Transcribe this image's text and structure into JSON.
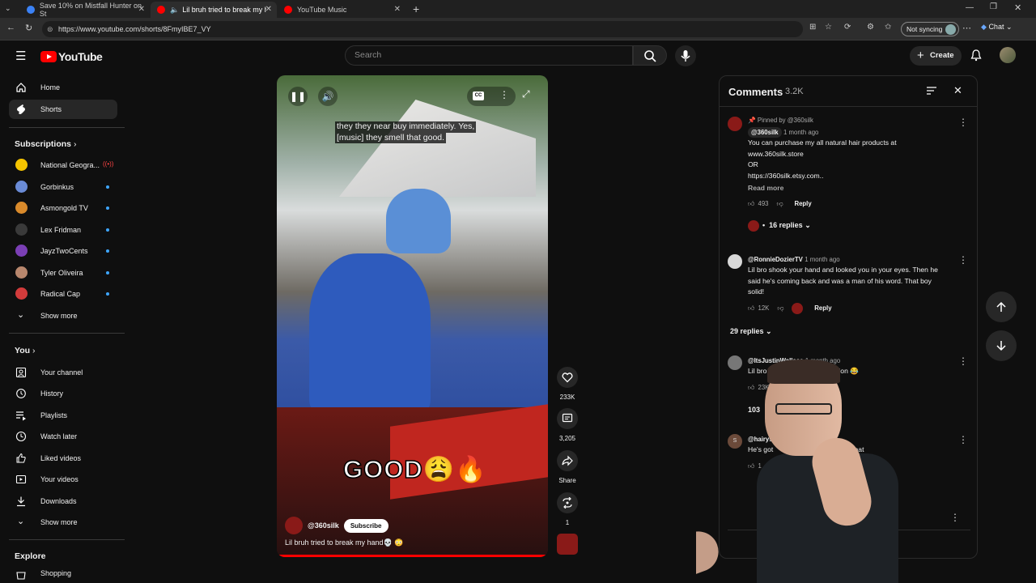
{
  "browser": {
    "tabs": [
      {
        "label": "Save 10% on Mistfall Hunter on St",
        "favicon_color": "#3b82f6"
      },
      {
        "label": "Lil bruh tried to break my hand",
        "favicon_color": "#ff0000"
      },
      {
        "label": "YouTube Music",
        "favicon_color": "#ff0000"
      }
    ],
    "url": "https://www.youtube.com/shorts/8FmyIBE7_VY",
    "sync_label": "Not syncing",
    "chat_label": "Chat"
  },
  "header": {
    "logo_text": "YouTube",
    "search_placeholder": "Search",
    "create_label": "Create"
  },
  "sidebar": {
    "main": [
      {
        "label": "Home",
        "icon": "home-icon"
      },
      {
        "label": "Shorts",
        "icon": "shorts-icon"
      }
    ],
    "subscriptions_title": "Subscriptions",
    "subscriptions": [
      {
        "label": "National Geogra...",
        "color": "#f5c400",
        "live": true
      },
      {
        "label": "Gorbinkus",
        "color": "#6a8bd6"
      },
      {
        "label": "Asmongold TV",
        "color": "#d98a2b"
      },
      {
        "label": "Lex Fridman",
        "color": "#2a2a2a"
      },
      {
        "label": "JayzTwoCents",
        "color": "#7b3fb5"
      },
      {
        "label": "Tyler Oliveira",
        "color": "#b8876d"
      },
      {
        "label": "Radical Cap",
        "color": "#d23b3b"
      }
    ],
    "show_more": "Show more",
    "you_title": "You",
    "you_items": [
      {
        "label": "Your channel",
        "icon": "account-icon"
      },
      {
        "label": "History",
        "icon": "history-icon"
      },
      {
        "label": "Playlists",
        "icon": "playlists-icon"
      },
      {
        "label": "Watch later",
        "icon": "watch-later-icon"
      },
      {
        "label": "Liked videos",
        "icon": "like-icon"
      },
      {
        "label": "Your videos",
        "icon": "your-videos-icon"
      },
      {
        "label": "Downloads",
        "icon": "download-icon"
      }
    ],
    "show_more_2": "Show more",
    "explore_title": "Explore",
    "explore_first": "Shopping"
  },
  "video": {
    "caption_line1": "they they near buy immediately. Yes,",
    "caption_line2": "[music] they smell that good.",
    "overlay_text": "GOOD😩🔥",
    "channel": "@360silk",
    "subscribe_label": "Subscribe",
    "title": "Lil bruh tried to break my hand💀 😳",
    "progress": 1.0
  },
  "actions": {
    "likes": "233K",
    "comments": "3,205",
    "share": "Share",
    "remix": "1"
  },
  "comments": {
    "title": "Comments",
    "count": "3.2K",
    "items": [
      {
        "pinned_label": "Pinned by @360silk",
        "user": "@360silk",
        "time": "1 month ago",
        "lines": [
          "You can purchase my all natural hair products at",
          "www.360silk.store",
          "OR",
          "https://360silk.etsy.com.."
        ],
        "read_more": "Read more",
        "likes": "493",
        "reply": "Reply",
        "replies": "16 replies",
        "avatar_color": "#8a1a18"
      },
      {
        "user": "@RonnieDozierTV",
        "time": "1 month ago",
        "lines": [
          "Lil bro shook your hand and looked you in your eyes. Then he",
          "said he's coming back and was a man of his word. That boy",
          "solid!"
        ],
        "likes": "12K",
        "reply": "Reply",
        "replies": "29 replies",
        "avatar_color": "#d8d8d8"
      },
      {
        "user": "@ItsJustinWallace",
        "time": "1 month ago",
        "lines": [
          "Lil bro di",
          "detention 😂"
        ],
        "likes": "23K",
        "replies": "103",
        "avatar_color": "#777777"
      },
      {
        "user": "@hairys",
        "lines": [
          "He's got",
          "is like that"
        ],
        "likes": "1",
        "avatar_color": "#6b4a3a",
        "avatar_letter": "S"
      }
    ]
  }
}
